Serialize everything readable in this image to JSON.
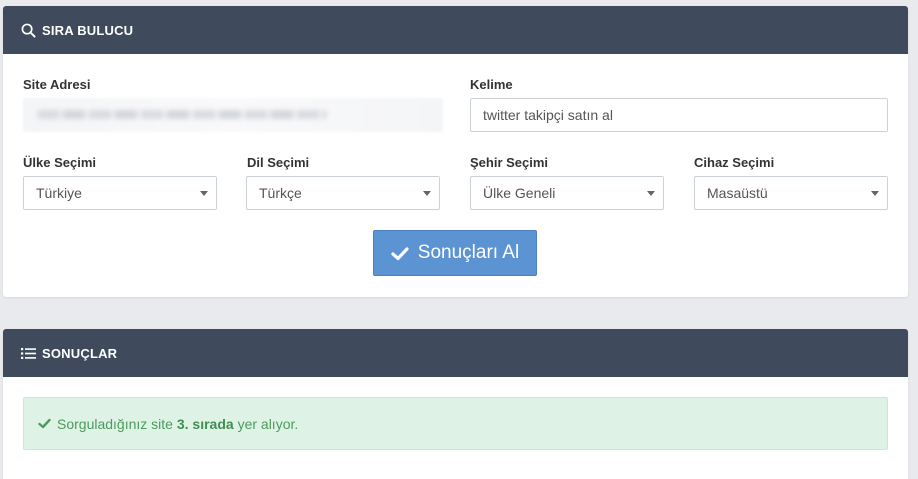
{
  "finder_panel": {
    "title": "SIRA BULUCU",
    "site_label": "Site Adresi",
    "keyword_label": "Kelime",
    "keyword_value": "twitter takipçi satın al",
    "country_label": "Ülke Seçimi",
    "country_value": "Türkiye",
    "language_label": "Dil Seçimi",
    "language_value": "Türkçe",
    "city_label": "Şehir Seçimi",
    "city_value": "Ülke Geneli",
    "device_label": "Cihaz Seçimi",
    "device_value": "Masaüstü",
    "submit_label": "Sonuçları Al"
  },
  "results_panel": {
    "title": "SONUÇLAR",
    "message_prefix": "Sorguladığınız site ",
    "message_rank": "3. sırada",
    "message_suffix": " yer alıyor."
  },
  "colors": {
    "header_bg": "#3f4b5c",
    "button_bg": "#5b93d3",
    "success_bg": "#dff2e6",
    "success_text": "#4a9b5e"
  }
}
